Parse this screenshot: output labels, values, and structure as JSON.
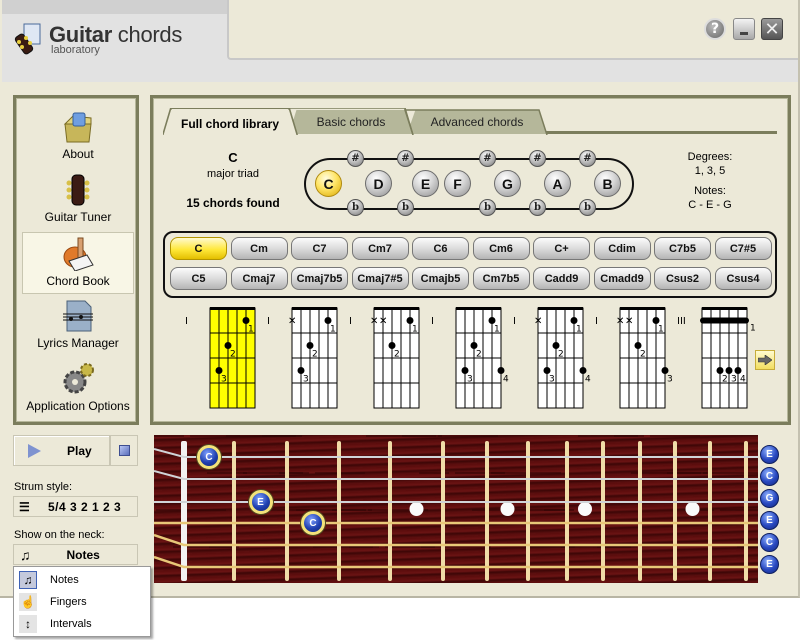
{
  "app": {
    "title_bold": "Guitar",
    "title_rest": " chords",
    "subtitle": "laboratory",
    "window_controls": {
      "help": "?",
      "minimize": "minimize-icon",
      "close": "✕"
    }
  },
  "sidebar": {
    "items": [
      {
        "label": "About",
        "icon": "box-icon",
        "active": false
      },
      {
        "label": "Guitar Tuner",
        "icon": "guitar-head-icon",
        "active": false
      },
      {
        "label": "Chord Book",
        "icon": "chord-book-icon",
        "active": true
      },
      {
        "label": "Lyrics Manager",
        "icon": "sheet-music-icon",
        "active": false
      },
      {
        "label": "Application Options",
        "icon": "gears-icon",
        "active": false
      }
    ]
  },
  "tabs": [
    {
      "label": "Full chord library",
      "active": true
    },
    {
      "label": "Basic chords",
      "active": false
    },
    {
      "label": "Advanced chords",
      "active": false
    }
  ],
  "chord_info": {
    "name": "C",
    "type": "major triad",
    "found": "15 chords found",
    "degrees_label": "Degrees:",
    "degrees": "1, 3, 5",
    "notes_label": "Notes:",
    "notes": "C - E - G"
  },
  "note_selector": {
    "naturals": [
      "C",
      "D",
      "E",
      "F",
      "G",
      "A",
      "B"
    ],
    "selected": "C",
    "sharp_symbol": "#",
    "flat_symbol": "b"
  },
  "chord_buttons": {
    "row1": [
      "C",
      "Cm",
      "C7",
      "Cm7",
      "C6",
      "Cm6",
      "C+",
      "Cdim",
      "C7b5",
      "C7#5"
    ],
    "row2": [
      "C5",
      "Cmaj7",
      "Cmaj7b5",
      "Cmaj7#5",
      "Cmajb5",
      "Cm7b5",
      "Cadd9",
      "Cmadd9",
      "Csus2",
      "Csus4"
    ],
    "selected": "C"
  },
  "diagrams": [
    {
      "position": "I",
      "selected": true,
      "muted": [],
      "dots": [
        {
          "s": 4,
          "f": 1,
          "n": "1"
        },
        {
          "s": 2,
          "f": 2,
          "n": "2"
        },
        {
          "s": 1,
          "f": 3,
          "n": "3"
        }
      ],
      "barre": null
    },
    {
      "position": "I",
      "selected": false,
      "muted": [
        0
      ],
      "dots": [
        {
          "s": 4,
          "f": 1,
          "n": "1"
        },
        {
          "s": 2,
          "f": 2,
          "n": "2"
        },
        {
          "s": 1,
          "f": 3,
          "n": "3"
        }
      ],
      "barre": null
    },
    {
      "position": "I",
      "selected": false,
      "muted": [
        0,
        1
      ],
      "dots": [
        {
          "s": 4,
          "f": 1,
          "n": "1"
        },
        {
          "s": 2,
          "f": 2,
          "n": "2"
        }
      ],
      "barre": null
    },
    {
      "position": "I",
      "selected": false,
      "muted": [],
      "dots": [
        {
          "s": 4,
          "f": 1,
          "n": "1"
        },
        {
          "s": 2,
          "f": 2,
          "n": "2"
        },
        {
          "s": 1,
          "f": 3,
          "n": "3"
        },
        {
          "s": 5,
          "f": 3,
          "n": "4"
        }
      ],
      "barre": null
    },
    {
      "position": "I",
      "selected": false,
      "muted": [
        0
      ],
      "dots": [
        {
          "s": 4,
          "f": 1,
          "n": "1"
        },
        {
          "s": 2,
          "f": 2,
          "n": "2"
        },
        {
          "s": 1,
          "f": 3,
          "n": "3"
        },
        {
          "s": 5,
          "f": 3,
          "n": "4"
        }
      ],
      "barre": null
    },
    {
      "position": "I",
      "selected": false,
      "muted": [
        0,
        1
      ],
      "dots": [
        {
          "s": 4,
          "f": 1,
          "n": "1"
        },
        {
          "s": 2,
          "f": 2,
          "n": "2"
        },
        {
          "s": 5,
          "f": 3,
          "n": "3"
        }
      ],
      "barre": null
    },
    {
      "position": "III",
      "selected": false,
      "muted": [],
      "dots": [
        {
          "s": 2,
          "f": 3,
          "n": "2"
        },
        {
          "s": 3,
          "f": 3,
          "n": "3"
        },
        {
          "s": 4,
          "f": 3,
          "n": "4"
        }
      ],
      "barre": {
        "f": 1,
        "n": "1"
      }
    }
  ],
  "next_button_icon": "arrow-right-icon",
  "controls": {
    "play_label": "Play",
    "strum_label": "Strum style:",
    "strum_value": "5/4 3 2 1 2 3",
    "neck_label": "Show on the neck:",
    "neck_value": "Notes",
    "neck_options": [
      {
        "label": "Notes",
        "icon": "note-icon",
        "selected": true
      },
      {
        "label": "Fingers",
        "icon": "hand-icon",
        "selected": false
      },
      {
        "label": "Intervals",
        "icon": "interval-icon",
        "selected": false
      }
    ]
  },
  "fretboard": {
    "open_strings": [
      "E",
      "C",
      "G",
      "E",
      "C",
      "E"
    ],
    "fretted_notes": [
      {
        "string": 1,
        "fret": 1,
        "note": "C"
      },
      {
        "string": 3,
        "fret": 2,
        "note": "E"
      },
      {
        "string": 4,
        "fret": 3,
        "note": "C"
      }
    ],
    "inlay_frets": [
      5,
      7,
      9,
      12
    ]
  }
}
